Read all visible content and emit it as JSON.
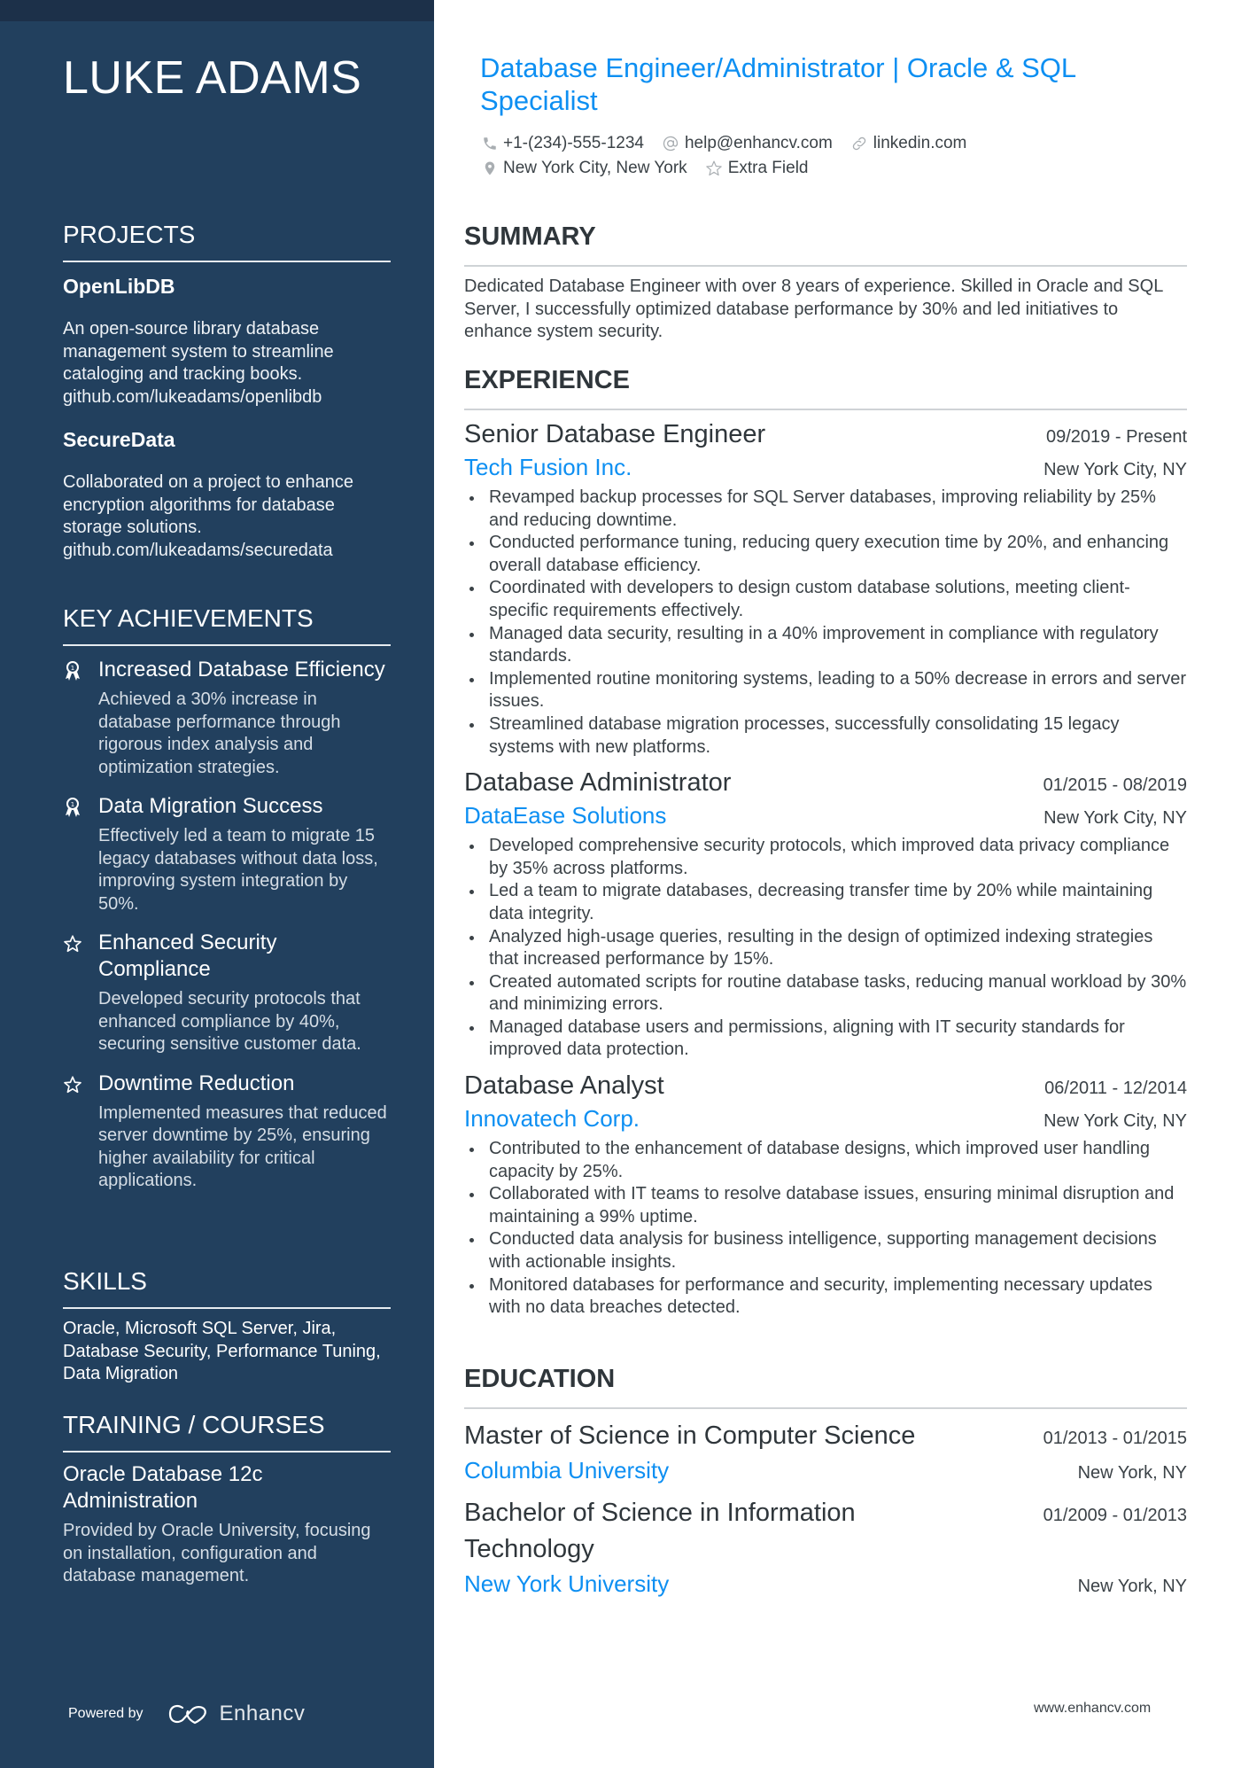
{
  "name": "LUKE ADAMS",
  "headline": "Database Engineer/Administrator | Oracle & SQL Specialist",
  "contacts": {
    "phone": {
      "icon": "phone-icon",
      "text": "+1-(234)-555-1234"
    },
    "email": {
      "icon": "at-icon",
      "text": "help@enhancv.com"
    },
    "link": {
      "icon": "link-icon",
      "text": "linkedin.com"
    },
    "location": {
      "icon": "location-pin-icon",
      "text": "New York City, New York"
    },
    "extra": {
      "icon": "star-icon",
      "text": "Extra Field"
    }
  },
  "projects": {
    "title": "PROJECTS",
    "items": [
      {
        "name": "OpenLibDB",
        "description": "An open-source library database management system to streamline cataloging and tracking books.",
        "link": "github.com/lukeadams/openlibdb"
      },
      {
        "name": "SecureData",
        "description": "Collaborated on a project to enhance encryption algorithms for database storage solutions.",
        "link": "github.com/lukeadams/securedata"
      }
    ]
  },
  "achievements": {
    "title": "KEY ACHIEVEMENTS",
    "items": [
      {
        "icon": "award-ribbon-icon",
        "title": "Increased Database Efficiency",
        "description": "Achieved a 30% increase in database performance through rigorous index analysis and optimization strategies."
      },
      {
        "icon": "award-ribbon-icon",
        "title": "Data Migration Success",
        "description": "Effectively led a team to migrate 15 legacy databases without data loss, improving system integration by 50%."
      },
      {
        "icon": "star-icon",
        "title": "Enhanced Security Compliance",
        "description": "Developed security protocols that enhanced compliance by 40%, securing sensitive customer data."
      },
      {
        "icon": "star-icon",
        "title": "Downtime Reduction",
        "description": "Implemented measures that reduced server downtime by 25%, ensuring higher availability for critical applications."
      }
    ]
  },
  "skills": {
    "title": "SKILLS",
    "text": "Oracle, Microsoft SQL Server, Jira, Database Security, Performance Tuning, Data Migration"
  },
  "training": {
    "title": "TRAINING / COURSES",
    "items": [
      {
        "title": "Oracle Database 12c Administration",
        "description": "Provided by Oracle University, focusing on installation, configuration and database management."
      }
    ]
  },
  "summary": {
    "title": "SUMMARY",
    "text": "Dedicated Database Engineer with over 8 years of experience. Skilled in Oracle and SQL Server, I successfully optimized database performance by 30% and led initiatives to enhance system security."
  },
  "experience": {
    "title": "EXPERIENCE",
    "jobs": [
      {
        "title": "Senior Database Engineer",
        "dates": "09/2019 - Present",
        "company": "Tech Fusion Inc.",
        "location": "New York City, NY",
        "bullets": [
          "Revamped backup processes for SQL Server databases, improving reliability by 25% and reducing downtime.",
          "Conducted performance tuning, reducing query execution time by 20%, and enhancing overall database efficiency.",
          "Coordinated with developers to design custom database solutions, meeting client-specific requirements effectively.",
          "Managed data security, resulting in a 40% improvement in compliance with regulatory standards.",
          "Implemented routine monitoring systems, leading to a 50% decrease in errors and server issues.",
          "Streamlined database migration processes, successfully consolidating 15 legacy systems with new platforms."
        ]
      },
      {
        "title": "Database Administrator",
        "dates": "01/2015 - 08/2019",
        "company": "DataEase Solutions",
        "location": "New York City, NY",
        "bullets": [
          "Developed comprehensive security protocols, which improved data privacy compliance by 35% across platforms.",
          "Led a team to migrate databases, decreasing transfer time by 20% while maintaining data integrity.",
          "Analyzed high-usage queries, resulting in the design of optimized indexing strategies that increased performance by 15%.",
          "Created automated scripts for routine database tasks, reducing manual workload by 30% and minimizing errors.",
          "Managed database users and permissions, aligning with IT security standards for improved data protection."
        ]
      },
      {
        "title": "Database Analyst",
        "dates": "06/2011 - 12/2014",
        "company": "Innovatech Corp.",
        "location": "New York City, NY",
        "bullets": [
          "Contributed to the enhancement of database designs, which improved user handling capacity by 25%.",
          "Collaborated with IT teams to resolve database issues, ensuring minimal disruption and maintaining a 99% uptime.",
          "Conducted data analysis for business intelligence, supporting management decisions with actionable insights.",
          "Monitored databases for performance and security, implementing necessary updates with no data breaches detected."
        ]
      }
    ]
  },
  "education": {
    "title": "EDUCATION",
    "items": [
      {
        "degree": "Master of Science in Computer Science",
        "dates": "01/2013 - 01/2015",
        "school": "Columbia University",
        "location": "New York, NY"
      },
      {
        "degree": "Bachelor of Science in Information Technology",
        "dates": "01/2009 - 01/2013",
        "school": "New York University",
        "location": "New York, NY"
      }
    ]
  },
  "footer": {
    "powered_by": "Powered by",
    "brand": "Enhancv",
    "url": "www.enhancv.com"
  },
  "colors": {
    "sidebar": "#22405e",
    "sidebar_top": "#1c3049",
    "accent": "#0d8ff2",
    "text": "#3b4247"
  }
}
